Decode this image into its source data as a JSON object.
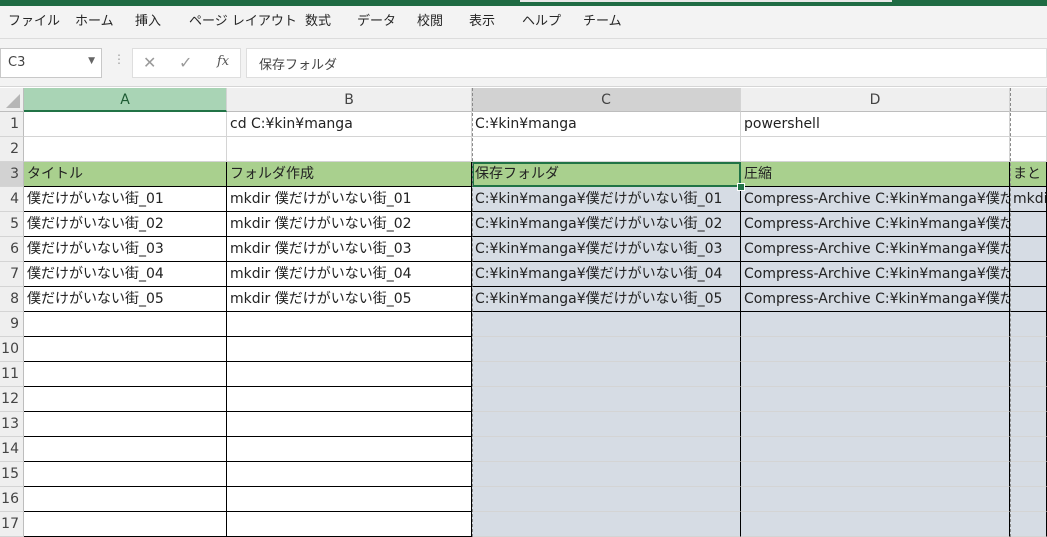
{
  "ribbon": {
    "tabs": [
      "ファイル",
      "ホーム",
      "挿入",
      "ページ レイアウト",
      "数式",
      "データ",
      "校閲",
      "表示",
      "ヘルプ",
      "チーム"
    ]
  },
  "formula_bar": {
    "name_box": "C3",
    "fx_icon": "fx",
    "formula": "保存フォルダ"
  },
  "columns": [
    "A",
    "B",
    "C",
    "D"
  ],
  "rows": [
    "1",
    "2",
    "3",
    "4",
    "5",
    "6",
    "7",
    "8",
    "9",
    "10",
    "11",
    "12",
    "13",
    "14",
    "15",
    "16",
    "17"
  ],
  "cells": {
    "r1": {
      "A": "",
      "B": "cd C:¥kin¥manga",
      "C": "C:¥kin¥manga",
      "D": "powershell",
      "E": ""
    },
    "r2": {
      "A": "",
      "B": "",
      "C": "",
      "D": "",
      "E": ""
    },
    "r3": {
      "A": "タイトル",
      "B": "フォルダ作成",
      "C": "保存フォルダ",
      "D": "圧縮",
      "E": "まと"
    },
    "r4": {
      "A": "僕だけがいない街_01",
      "B": "mkdir 僕だけがいない街_01",
      "C": "C:¥kin¥manga¥僕だけがいない街_01",
      "D": "Compress-Archive C:¥kin¥manga¥僕だ",
      "E": "mkdi"
    },
    "r5": {
      "A": "僕だけがいない街_02",
      "B": "mkdir 僕だけがいない街_02",
      "C": "C:¥kin¥manga¥僕だけがいない街_02",
      "D": "Compress-Archive C:¥kin¥manga¥僕だ",
      "E": ""
    },
    "r6": {
      "A": "僕だけがいない街_03",
      "B": "mkdir 僕だけがいない街_03",
      "C": "C:¥kin¥manga¥僕だけがいない街_03",
      "D": "Compress-Archive C:¥kin¥manga¥僕だ",
      "E": ""
    },
    "r7": {
      "A": "僕だけがいない街_04",
      "B": "mkdir 僕だけがいない街_04",
      "C": "C:¥kin¥manga¥僕だけがいない街_04",
      "D": "Compress-Archive C:¥kin¥manga¥僕だ",
      "E": ""
    },
    "r8": {
      "A": "僕だけがいない街_05",
      "B": "mkdir 僕だけがいない街_05",
      "C": "C:¥kin¥manga¥僕だけがいない街_05",
      "D": "Compress-Archive C:¥kin¥manga¥僕だ",
      "E": ""
    }
  },
  "colors": {
    "header_fill": "#a9d08e",
    "selected_column_fill": "#d6dce4",
    "excel_green": "#217346"
  }
}
